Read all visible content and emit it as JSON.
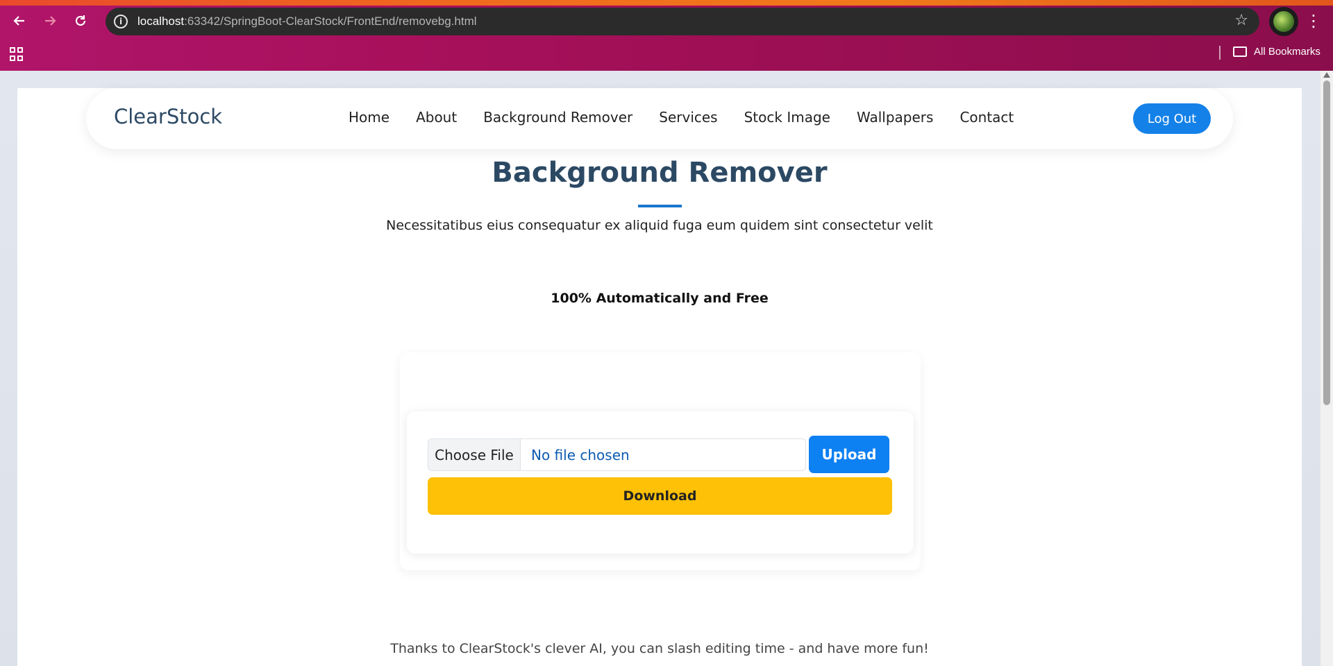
{
  "browser": {
    "url_host": "localhost",
    "url_path": ":63342/SpringBoot-ClearStock/FrontEnd/removebg.html",
    "bookmarks_label": "All Bookmarks",
    "icons": [
      "back-arrow-icon",
      "forward-arrow-icon",
      "reload-icon",
      "info-icon",
      "star-icon",
      "profile-avatar",
      "kebab-menu-icon",
      "apps-grid-icon",
      "folder-icon"
    ]
  },
  "navbar": {
    "brand": "ClearStock",
    "items": [
      "Home",
      "About",
      "Background Remover",
      "Services",
      "Stock Image",
      "Wallpapers",
      "Contact"
    ],
    "logout_label": "Log Out"
  },
  "hero": {
    "title": "Background Remover",
    "subtitle": "Necessitatibus eius consequatur ex aliquid fuga eum quidem sint consectetur velit",
    "tagline": "100% Automatically and Free"
  },
  "uploader": {
    "choose_file_label": "Choose File",
    "file_status": "No file chosen",
    "upload_label": "Upload",
    "download_label": "Download"
  },
  "footer": {
    "text": "Thanks to ClearStock's clever AI, you can slash editing time - and have more fun!"
  },
  "colors": {
    "accent_blue": "#0d80f2",
    "download_yellow": "#ffc107",
    "heading_navy": "#2c4964",
    "browser_frame": "#9c0f54"
  }
}
